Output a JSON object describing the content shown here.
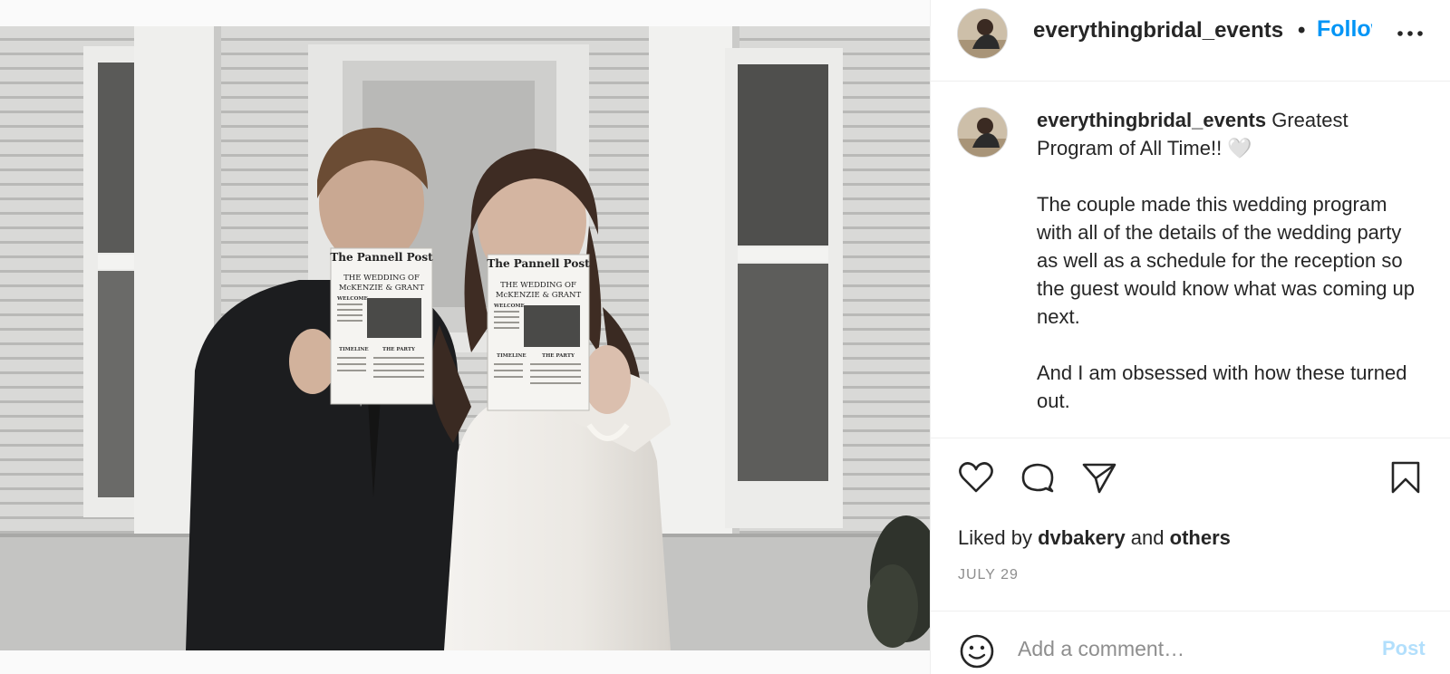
{
  "post": {
    "username": "everythingbridal_events",
    "separator": "•",
    "follow_label": "Follow",
    "more_icon": "more-horizontal-icon",
    "caption": {
      "username": "everythingbridal_events",
      "line1": " Greatest Program of All Time!! 🤍",
      "paragraph2": "The couple made this wedding program with all of the details of the wedding party as well as a schedule for the reception so the guest would know what was coming up next.",
      "paragraph3": "And I am obsessed with how these turned out."
    },
    "actions": {
      "like_icon": "heart-icon",
      "comment_icon": "comment-icon",
      "share_icon": "paper-plane-icon",
      "save_icon": "bookmark-icon"
    },
    "likes": {
      "prefix": "Liked by ",
      "user": "dvbakery",
      "conjunction": " and ",
      "others": "others"
    },
    "date": "JULY 29",
    "comment": {
      "emoji_icon": "emoji-icon",
      "placeholder": "Add a comment…",
      "post_label": "Post"
    }
  },
  "media": {
    "newspaper_title": "The Pannell Post",
    "headline_1": "THE WEDDING OF",
    "headline_2": "McKENZIE & GRANT",
    "section_welcome": "WELCOME",
    "section_timeline": "TIMELINE",
    "section_party": "THE PARTY"
  },
  "colors": {
    "accent_blue": "#0095f6",
    "post_disabled": "#b2dffc",
    "muted_text": "#8e8e8e"
  }
}
